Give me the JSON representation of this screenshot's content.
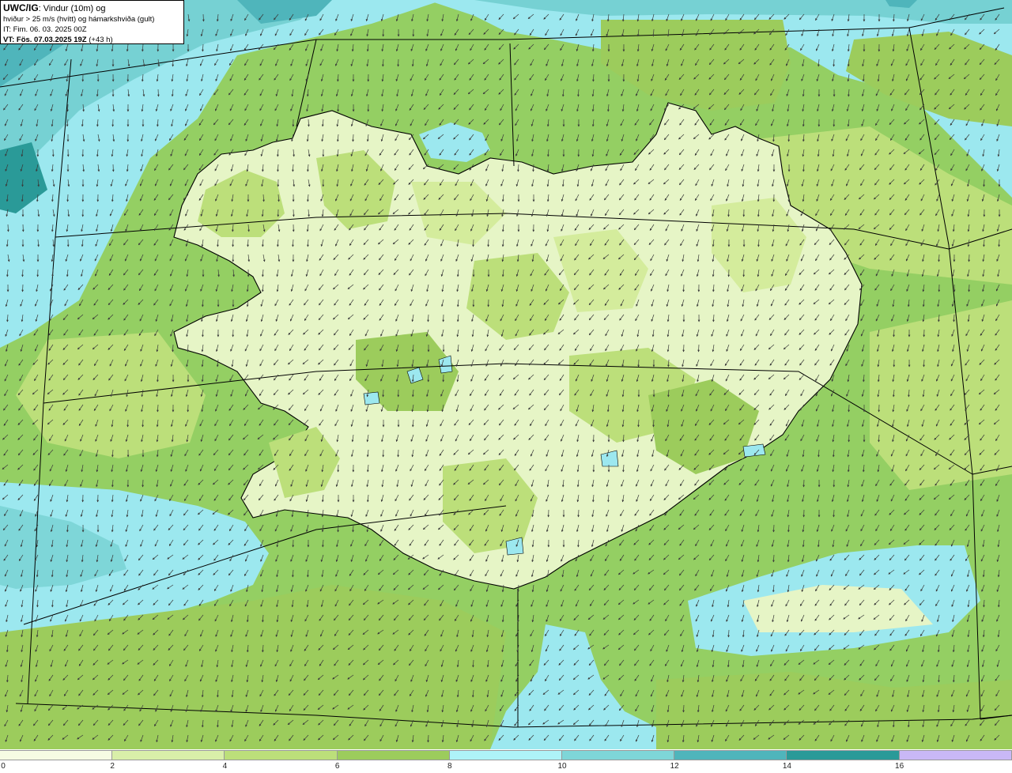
{
  "header": {
    "model": "UWC/IG",
    "title_suffix": ": Vindur (10m) og",
    "subtitle": "hviður > 25 m/s (hvítt) og hámarkshviða (gult)",
    "init_time": "IT: Fim. 06. 03. 2025 00Z",
    "valid_time_label": "VT: Fös. 07.03.2025 19Z",
    "valid_offset": " (+43 h)"
  },
  "legend": {
    "ticks": [
      "0",
      "2",
      "4",
      "6",
      "8",
      "10",
      "12",
      "14",
      "16"
    ],
    "colors": [
      "#f6fbe3",
      "#d9efa9",
      "#bcdf7a",
      "#9ccc5c",
      "#aef3f8",
      "#7ed6d8",
      "#4fb5bb",
      "#2a9a98",
      "#c9b8f6",
      "#ffffff"
    ]
  },
  "map": {
    "land_color": "#e6f5c6",
    "sea_color": "#94cf63",
    "coast_color": "#000000",
    "arrow_color": "#3a3a3a",
    "grid_line_color": "#000000"
  }
}
